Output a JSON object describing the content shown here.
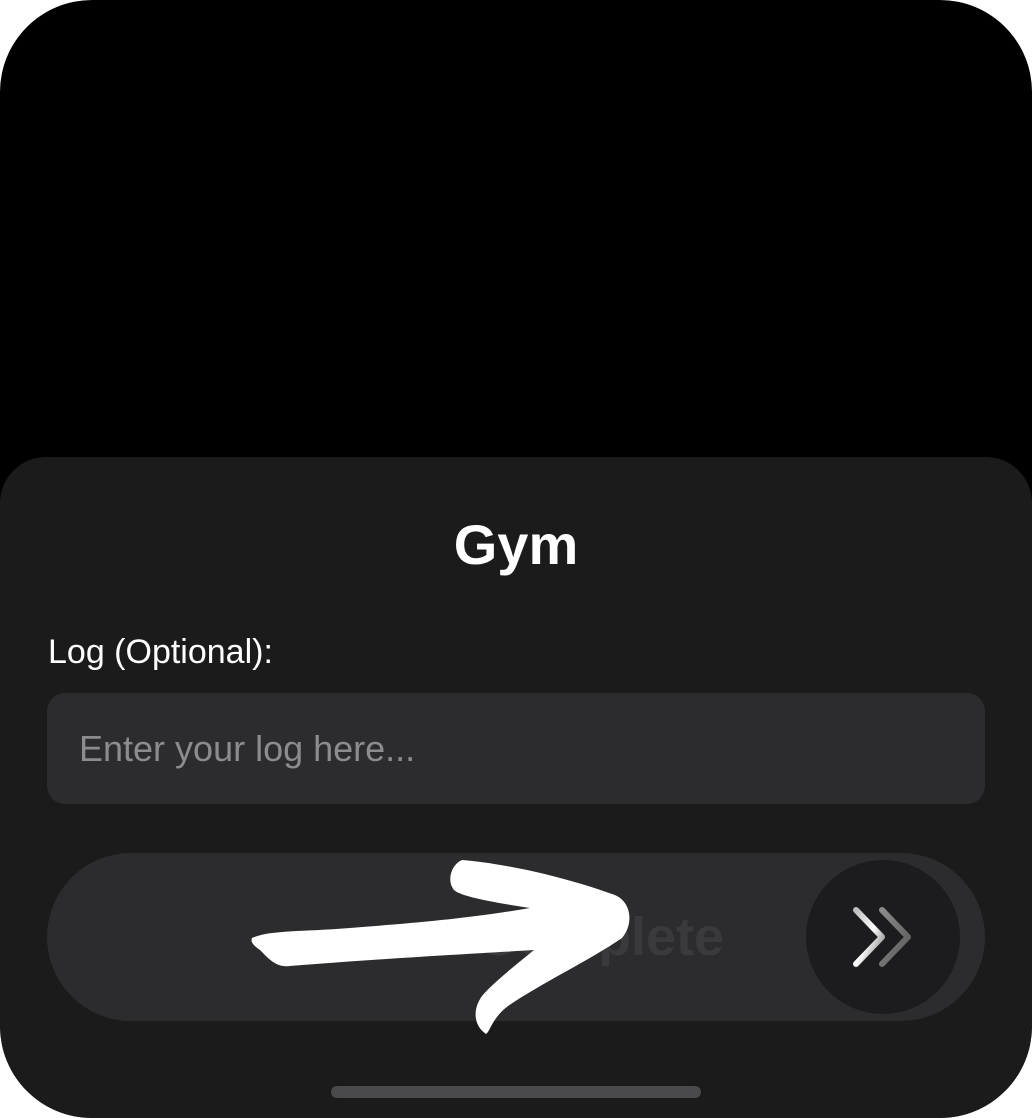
{
  "sheet": {
    "title": "Gym",
    "log_label": "Log (Optional):",
    "log_placeholder": "Enter your log here...",
    "log_value": ""
  },
  "slider": {
    "label": "Complete",
    "knob_icon": "double-chevron-right-icon"
  },
  "annotation": {
    "icon": "hand-drawn-arrow-right-icon"
  },
  "colors": {
    "screen_background": "#000000",
    "sheet_background": "#1b1b1c",
    "input_background": "#2c2c2e",
    "knob_background": "#1c1c1e",
    "text_primary": "#ffffff",
    "placeholder": "#8c8c90"
  }
}
